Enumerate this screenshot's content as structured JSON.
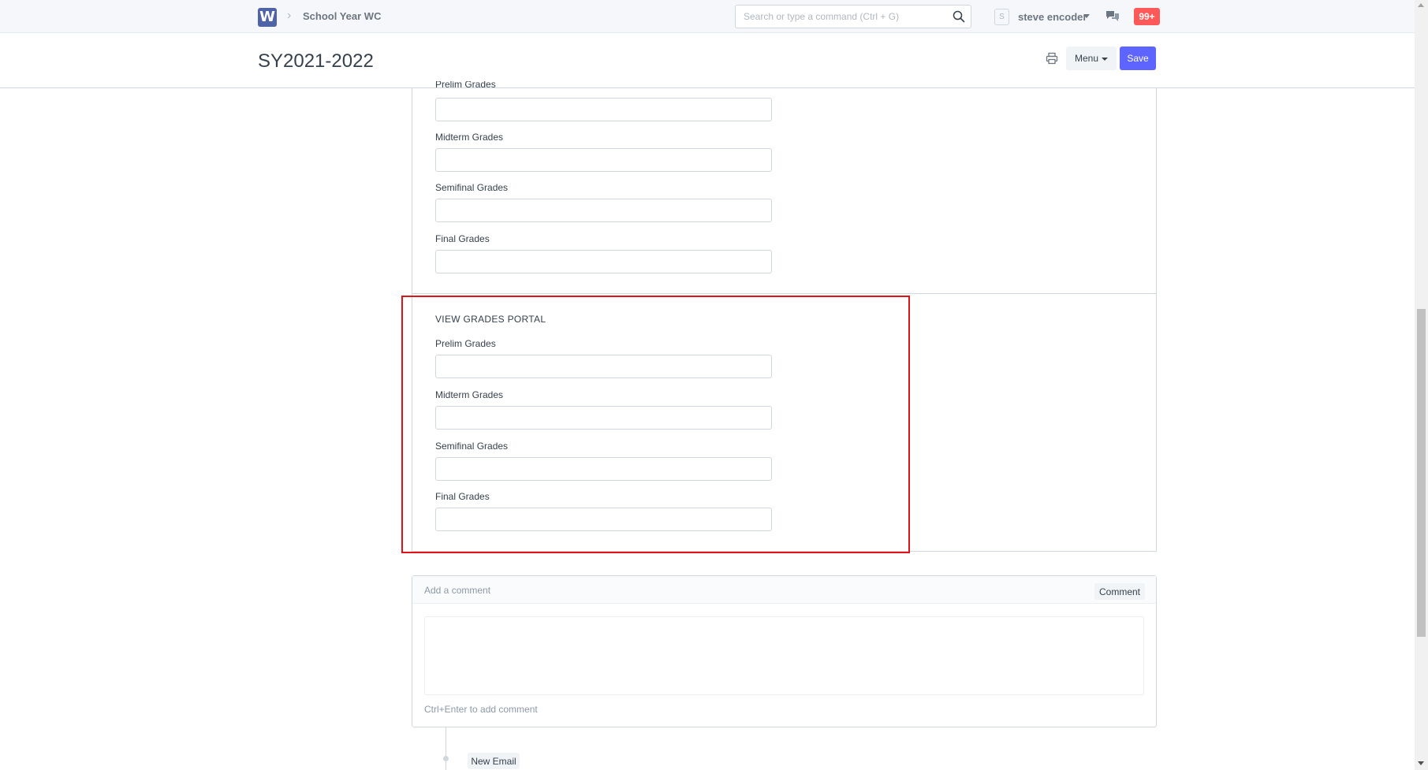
{
  "navbar": {
    "logo_letter": "W",
    "breadcrumb": "School Year WC",
    "search_placeholder": "Search or type a command (Ctrl + G)",
    "user_initial": "S",
    "user_name": "steve encoder",
    "notification_count": "99+",
    "icons": [
      "search-icon",
      "chat-icon"
    ]
  },
  "page": {
    "title": "SY2021-2022",
    "menu_label": "Menu",
    "save_label": "Save",
    "accent_color": "#5e64ff",
    "icons": [
      "print-icon"
    ]
  },
  "form": {
    "upper_section": {
      "cut_label": "Prelim Grades",
      "fields": [
        {
          "label": "Midterm Grades",
          "value": ""
        },
        {
          "label": "Semifinal Grades",
          "value": ""
        },
        {
          "label": "Final Grades",
          "value": ""
        }
      ]
    },
    "portal_section": {
      "heading": "VIEW GRADES PORTAL",
      "highlight_color": "#e0131a",
      "fields": [
        {
          "label": "Prelim Grades",
          "value": ""
        },
        {
          "label": "Midterm Grades",
          "value": ""
        },
        {
          "label": "Semifinal Grades",
          "value": ""
        },
        {
          "label": "Final Grades",
          "value": ""
        }
      ]
    }
  },
  "comments": {
    "placeholder": "Add a comment",
    "button_label": "Comment",
    "hint": "Ctrl+Enter to add comment"
  },
  "timeline": {
    "new_email_label": "New Email"
  }
}
